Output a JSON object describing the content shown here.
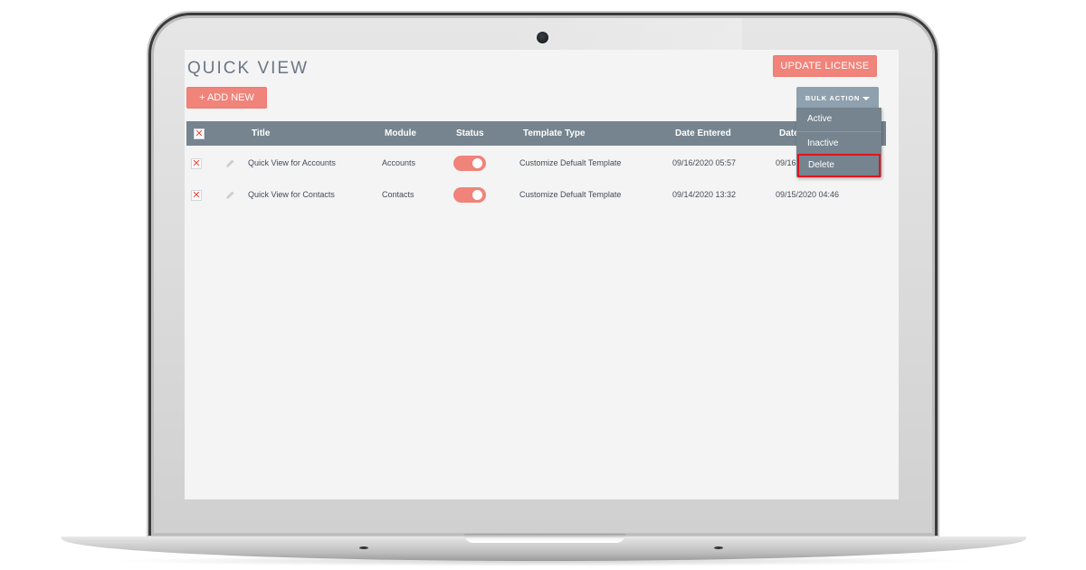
{
  "page": {
    "title": "QUICK VIEW",
    "add_new_label": "+ ADD NEW",
    "update_license_label": "UPDATE LICENSE",
    "bulk_action_label": "BULK ACTION"
  },
  "bulk_action_menu": {
    "items": [
      {
        "label": "Active",
        "highlighted": false
      },
      {
        "label": "Inactive",
        "highlighted": false
      },
      {
        "label": "Delete",
        "highlighted": true
      }
    ]
  },
  "table": {
    "columns": [
      "",
      "",
      "Title",
      "Module",
      "Status",
      "Template Type",
      "Date Entered",
      "Date"
    ],
    "rows": [
      {
        "title": "Quick View for Accounts",
        "module": "Accounts",
        "status_on": true,
        "template_type": "Customize Defualt Template",
        "date_entered": "09/16/2020 05:57",
        "date_modified": "09/16"
      },
      {
        "title": "Quick View for Contacts",
        "module": "Contacts",
        "status_on": true,
        "template_type": "Customize Defualt Template",
        "date_entered": "09/14/2020 13:32",
        "date_modified": "09/15/2020 04:46"
      }
    ]
  },
  "colors": {
    "accent_salmon": "#f0837a",
    "header_slate": "#75848f",
    "bulk_button": "#8fa0ae",
    "delete_highlight": "#e0141e",
    "screen_bg": "#f4f4f4"
  },
  "icons": {
    "select_all": "close-x-icon",
    "row_delete": "close-x-icon",
    "row_edit": "pencil-icon",
    "bulk_caret": "caret-down-icon"
  }
}
